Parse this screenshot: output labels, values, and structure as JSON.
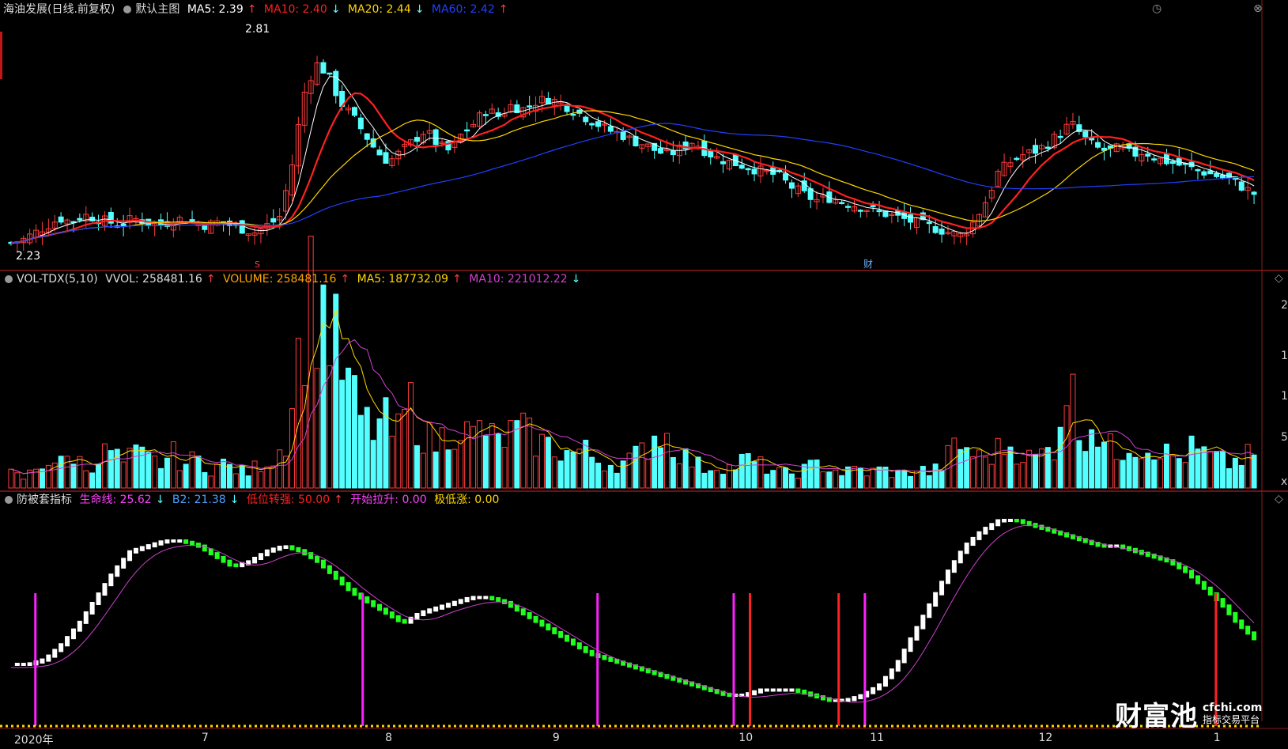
{
  "price_panel": {
    "stock": "海油发展(日线.前复权)",
    "main_chart": "默认主图",
    "ma5": {
      "label": "MA5: 2.39",
      "arrow": "↑",
      "color": "#ffffff"
    },
    "ma10": {
      "label": "MA10: 2.40",
      "arrow": "↓",
      "color": "#ff2020"
    },
    "ma20": {
      "label": "MA20: 2.44",
      "arrow": "↓",
      "color": "#ffd700"
    },
    "ma60": {
      "label": "MA60: 2.42",
      "arrow": "↑",
      "color": "#2040ff"
    },
    "high_label": "2.81",
    "low_label": "2.23",
    "marker_s": "S",
    "marker_cai": "财"
  },
  "volume_panel": {
    "name": "VOL-TDX(5,10)",
    "vvol": "VVOL: 258481.16",
    "vvol_arrow": "↑",
    "volume": "VOLUME: 258481.16",
    "volume_arrow": "↑",
    "ma5": "MA5: 187732.09",
    "ma5_arrow": "↑",
    "ma10": "MA10: 221012.22",
    "ma10_arrow": "↓",
    "right_labels": [
      "2",
      "1",
      "1",
      "5",
      "x"
    ]
  },
  "indicator_panel": {
    "name": "防被套指标",
    "lifeline": "生命线: 25.62",
    "lifeline_arrow": "↓",
    "b2": "B2: 21.38",
    "b2_arrow": "↓",
    "low_strong": "低位转强: 50.00",
    "low_strong_arrow": "↑",
    "start_rise": "开始拉升: 0.00",
    "extreme_low": "极低涨: 0.00"
  },
  "x_axis": {
    "labels": [
      "2020年",
      "7",
      "8",
      "9",
      "10",
      "11",
      "12",
      "1"
    ]
  },
  "watermark": {
    "brand": "财富池",
    "site": "cfchi.com",
    "tagline": "指标交易平台"
  },
  "colors": {
    "up": "#ff3c3c",
    "down": "#54ffff",
    "ma5": "#ffffff",
    "ma10": "#ff2020",
    "ma20": "#ffd700",
    "ma60": "#2040ff",
    "vol_ma5": "#ffd700",
    "vol_ma10": "#d040d0",
    "lifeline": "#d040d0",
    "rise_bar": "#ffffff",
    "fall_bar": "#20ff20",
    "signal_buy": "#ff20ff",
    "signal_sell": "#ff2020",
    "baseline": "#ffd700"
  },
  "chart_data": {
    "type": "candlestick",
    "x_ticks": [
      "2020年",
      "7",
      "8",
      "9",
      "10",
      "11",
      "12",
      "1"
    ],
    "price": {
      "high": 2.81,
      "low": 2.23,
      "ma5": 2.39,
      "ma10": 2.4,
      "ma20": 2.44,
      "ma60": 2.42
    },
    "volume": {
      "vvol": 258481.16,
      "ma5": 187732.09,
      "ma10": 221012.22
    },
    "indicator": {
      "lifeline": 25.62,
      "b2": 21.38,
      "low_strong": 50.0,
      "start_rise": 0.0,
      "extreme_low": 0.0
    },
    "price_trend": [
      2.24,
      2.25,
      2.27,
      2.29,
      2.31,
      2.3,
      2.32,
      2.31,
      2.3,
      2.29,
      2.31,
      2.3,
      2.29,
      2.3,
      2.31,
      2.3,
      2.29,
      2.3,
      2.29,
      2.28,
      2.27,
      2.29,
      2.31,
      2.45,
      2.66,
      2.75,
      2.72,
      2.64,
      2.6,
      2.55,
      2.5,
      2.47,
      2.5,
      2.53,
      2.56,
      2.52,
      2.5,
      2.55,
      2.58,
      2.62,
      2.6,
      2.63,
      2.62,
      2.64,
      2.65,
      2.64,
      2.62,
      2.6,
      2.58,
      2.56,
      2.55,
      2.53,
      2.52,
      2.5,
      2.49,
      2.51,
      2.53,
      2.5,
      2.48,
      2.47,
      2.46,
      2.45,
      2.44,
      2.43,
      2.4,
      2.38,
      2.36,
      2.37,
      2.36,
      2.35,
      2.34,
      2.33,
      2.32,
      2.31,
      2.3,
      2.29,
      2.28,
      2.27,
      2.26,
      2.3,
      2.36,
      2.44,
      2.47,
      2.49,
      2.5,
      2.52,
      2.55,
      2.58,
      2.54,
      2.51,
      2.5,
      2.51,
      2.49,
      2.5,
      2.48,
      2.47,
      2.46,
      2.45,
      2.44,
      2.43,
      2.42,
      2.4,
      2.38
    ],
    "volume_trend": [
      3,
      2,
      4,
      6,
      5,
      7,
      4,
      6,
      8,
      5,
      7,
      6,
      5,
      7,
      5,
      6,
      4,
      5,
      4,
      3,
      5,
      6,
      9,
      25,
      40,
      38,
      30,
      22,
      15,
      12,
      14,
      10,
      18,
      12,
      9,
      11,
      14,
      10,
      13,
      9,
      11,
      12,
      10,
      9,
      8,
      7,
      8,
      6,
      5,
      5,
      6,
      8,
      12,
      10,
      7,
      5,
      4,
      5,
      4,
      6,
      5,
      4,
      3,
      3,
      4,
      5,
      4,
      3,
      4,
      3,
      4,
      3,
      3,
      4,
      3,
      5,
      9,
      8,
      6,
      7,
      9,
      8,
      6,
      7,
      9,
      24,
      11,
      14,
      9,
      7,
      10,
      8,
      9,
      7,
      6,
      8,
      7,
      6,
      5,
      6,
      7
    ],
    "indicator_trend": [
      10,
      10,
      11,
      14,
      18,
      23,
      28,
      32,
      33,
      34,
      34,
      33,
      31,
      29,
      30,
      32,
      33,
      32,
      30,
      27,
      24,
      22,
      20,
      18,
      20,
      21,
      22,
      23,
      23,
      22,
      20,
      18,
      16,
      14,
      12,
      11,
      10,
      9,
      8,
      7,
      6,
      5,
      4,
      4,
      5,
      5,
      5,
      4,
      3,
      3,
      4,
      6,
      10,
      16,
      22,
      28,
      33,
      36,
      38,
      38,
      37,
      36,
      35,
      34,
      33,
      33,
      32,
      31,
      30,
      28,
      25,
      22,
      18,
      15
    ]
  }
}
